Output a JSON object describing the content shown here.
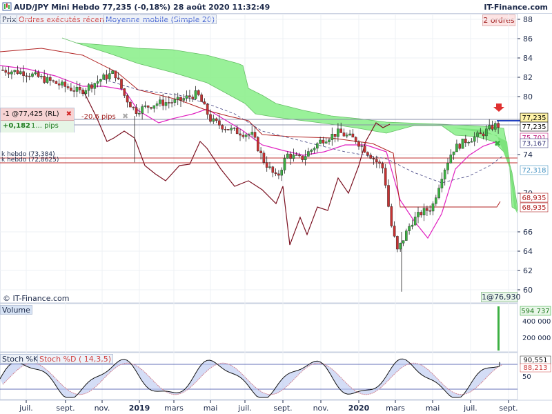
{
  "header": {
    "title": "AUD/JPY Mini   Hebdo   77,235 (-0,18%)   28 août 2020 11:32:49",
    "brand": "IT-Finance.com"
  },
  "legend": {
    "price": "Prix",
    "orders": "Ordres exécutés récents",
    "ma": "Moyenne mobile (Simple 20)",
    "orders_count": "2 ordres"
  },
  "order_box": {
    "order": "-1 @77,425 (RL)",
    "pnl": "+0,182",
    "qty": "1...",
    "pips_unit": "pips",
    "pips": "-20,6 pips"
  },
  "overlay_labels": {
    "hebdo_a": "k hebdo (73,384)",
    "hebdo_b": "k hebdo (72,8625)"
  },
  "price_axis": {
    "ticks": [
      "88",
      "86",
      "84",
      "82",
      "80",
      "74",
      "70",
      "66",
      "64",
      "62",
      "60"
    ],
    "tags": [
      {
        "label": "77,235",
        "bg": "#fff3a8",
        "fg": "#000000"
      },
      {
        "label": "77,235",
        "bg": "#ffffff",
        "fg": "#000000"
      },
      {
        "label": "75,701",
        "bg": "#ffffff",
        "fg": "#c02080"
      },
      {
        "label": "73,167",
        "bg": "#ffffff",
        "fg": "#404080"
      },
      {
        "label": "72,318",
        "bg": "#ffffff",
        "fg": "#4090c0"
      },
      {
        "label": "68,935",
        "bg": "#ffffff",
        "fg": "#b02020"
      },
      {
        "label": "68,935",
        "bg": "#ffffff",
        "fg": "#b02020"
      }
    ]
  },
  "footer": {
    "brand": "© IT-Finance.com",
    "position": "1@76,930"
  },
  "volume": {
    "label": "Volume",
    "current": "594 737",
    "ticks": [
      "400 000",
      "200 000"
    ]
  },
  "stoch": {
    "k_label": "Stoch %K",
    "d_label": "Stoch %D ( 14,3,5)",
    "k_value": "90,551",
    "d_value": "88,213",
    "ticks": [
      "50"
    ]
  },
  "time_axis": [
    "juil.",
    "sept.",
    "nov.",
    "2019",
    "mars",
    "mai",
    "juil.",
    "sept.",
    "nov.",
    "2020",
    "mars",
    "mai",
    "juil.",
    "sept."
  ],
  "colors": {
    "cloud_green": "#8ef08e",
    "cloud_red": "#f0a0a0",
    "bull": "#3cb043",
    "bear": "#c83232",
    "ma": "#e020c0",
    "accent_navy": "#1d2a4a"
  }
}
